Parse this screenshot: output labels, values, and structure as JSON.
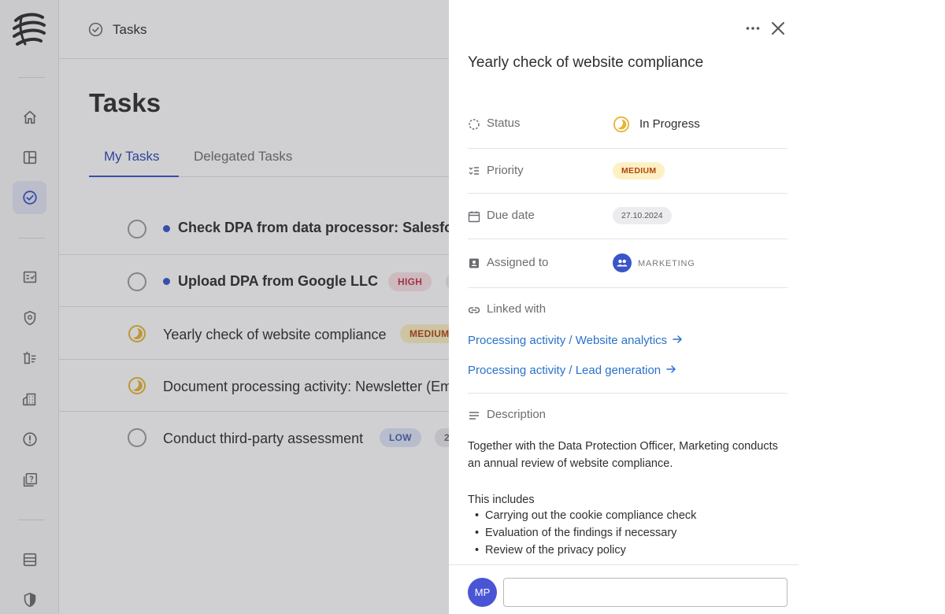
{
  "app": {
    "logo_icon": "app-logo-icon",
    "nav_items": [
      {
        "id": "home",
        "icon": "home-icon",
        "active": false
      },
      {
        "id": "dashboard",
        "icon": "layout-icon",
        "active": false
      },
      {
        "id": "tasks",
        "icon": "check-circle-icon",
        "active": true
      },
      {
        "id": "checklist",
        "icon": "checklist-icon",
        "active": false
      },
      {
        "id": "privacy",
        "icon": "shield-lock-icon",
        "active": false
      },
      {
        "id": "deletion",
        "icon": "trash-list-icon",
        "active": false
      },
      {
        "id": "companies",
        "icon": "building-icon",
        "active": false
      },
      {
        "id": "incidents",
        "icon": "alert-circle-icon",
        "active": false
      },
      {
        "id": "requests",
        "icon": "help-box-icon",
        "active": false
      },
      {
        "id": "records",
        "icon": "table-icon",
        "active": false
      },
      {
        "id": "security",
        "icon": "shield-half-icon",
        "active": false
      }
    ]
  },
  "header": {
    "breadcrumb": "Tasks"
  },
  "page": {
    "title": "Tasks",
    "tabs": [
      {
        "label": "My Tasks",
        "active": true
      },
      {
        "label": "Delegated Tasks",
        "active": false
      }
    ]
  },
  "tasks": [
    {
      "title": "Check DPA from data processor: Salesforce",
      "status": "open",
      "unread": true,
      "priority": "",
      "tag": ""
    },
    {
      "title": "Upload DPA from Google LLC",
      "status": "open",
      "unread": true,
      "priority": "HIGH",
      "tag": ""
    },
    {
      "title": "Yearly check of website compliance",
      "status": "in-progress",
      "unread": false,
      "priority": "MEDIUM",
      "tag": ""
    },
    {
      "title": "Document processing activity: Newsletter (Email)",
      "status": "in-progress",
      "unread": false,
      "priority": "",
      "tag": ""
    },
    {
      "title": "Conduct third-party assessment",
      "status": "open",
      "unread": false,
      "priority": "LOW",
      "tag": "2"
    }
  ],
  "drawer": {
    "title": "Yearly check of website compliance",
    "more_icon": "more-horizontal-icon",
    "close_icon": "close-icon",
    "status": {
      "label": "Status",
      "value": "In Progress",
      "icon": "status-dashed-circle-icon"
    },
    "priority": {
      "label": "Priority",
      "value": "MEDIUM",
      "icon": "priority-list-icon"
    },
    "due_date": {
      "label": "Due date",
      "value": "27.10.2024",
      "icon": "calendar-icon"
    },
    "assigned": {
      "label": "Assigned to",
      "value": "MARKETING",
      "icon": "assignee-badge-icon"
    },
    "linked": {
      "label": "Linked with",
      "icon": "link-icon",
      "items": [
        {
          "label": "Processing activity / Website analytics"
        },
        {
          "label": "Processing activity / Lead generation"
        }
      ]
    },
    "description": {
      "label": "Description",
      "icon": "text-lines-icon",
      "paragraph": "Together with the Data Protection Officer, Marketing conducts an annual review of website compliance.",
      "intro": "This includes",
      "bullets": [
        "Carrying out the cookie compliance check",
        "Evaluation of the findings if necessary",
        "Review of the privacy policy"
      ]
    },
    "comment": {
      "avatar_initials": "MP",
      "value": "",
      "placeholder": ""
    }
  },
  "colors": {
    "accent": "#3a55c9",
    "link": "#2a72c9",
    "progress": "#e6b436"
  }
}
